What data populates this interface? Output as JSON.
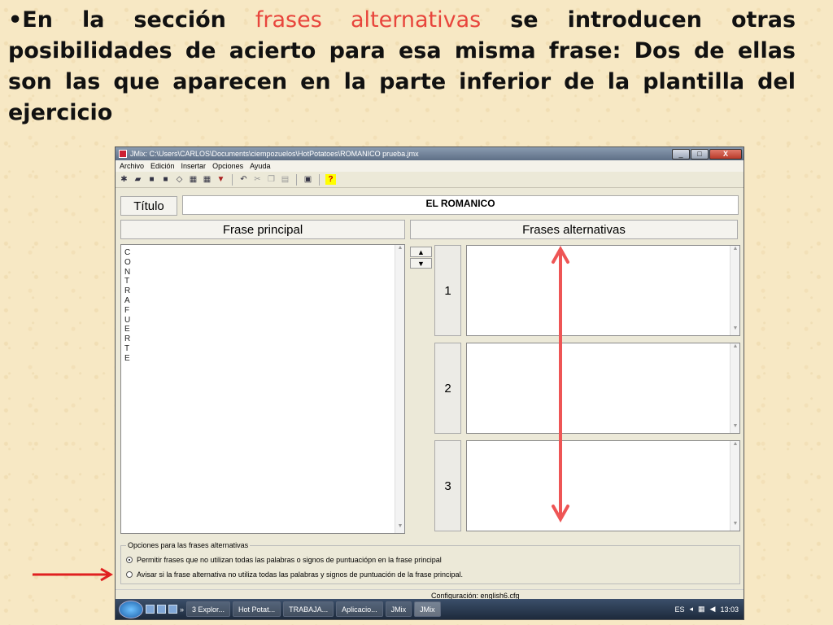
{
  "slide": {
    "bullet": "•",
    "text_before": "En la sección ",
    "highlight": "frases alternativas",
    "text_after": " se introducen otras posibilidades de acierto para esa misma frase: Dos de ellas son las que aparecen en la parte inferior de la plantilla del ejercicio"
  },
  "window": {
    "title": "JMix: C:\\Users\\CARLOS\\Documents\\ciempozuelos\\HotPotatoes\\ROMANICO prueba.jmx",
    "buttons": [
      "_",
      "□",
      "X"
    ]
  },
  "menu": [
    "Archivo",
    "Edición",
    "Insertar",
    "Opciones",
    "Ayuda"
  ],
  "form": {
    "title_label": "Título",
    "title_value": "EL ROMANICO",
    "main_header": "Frase principal",
    "alt_header": "Frases alternativas",
    "main_text": "CONTRAFUERTE",
    "alt_numbers": [
      "1",
      "2",
      "3"
    ]
  },
  "options": {
    "legend": "Opciones para las frases alternativas",
    "opt1": "Permitir frases que no utilizan todas las palabras o signos de puntuaciópn en la frase principal",
    "opt2": "Avisar si la frase alternativa no utiliza todas las palabras y signos de puntuación de la frase principal."
  },
  "status": {
    "config": "Configuración: english6.cfg"
  },
  "taskbar": {
    "tasks": [
      "3 Explor...",
      "Hot Potat...",
      "TRABAJA...",
      "Aplicacio...",
      "JMix",
      "JMix"
    ],
    "lang": "ES",
    "time": "13:03"
  },
  "colors": {
    "highlight": "#e8453c",
    "arrow": "#ee5555",
    "background": "#f7e8c4"
  }
}
